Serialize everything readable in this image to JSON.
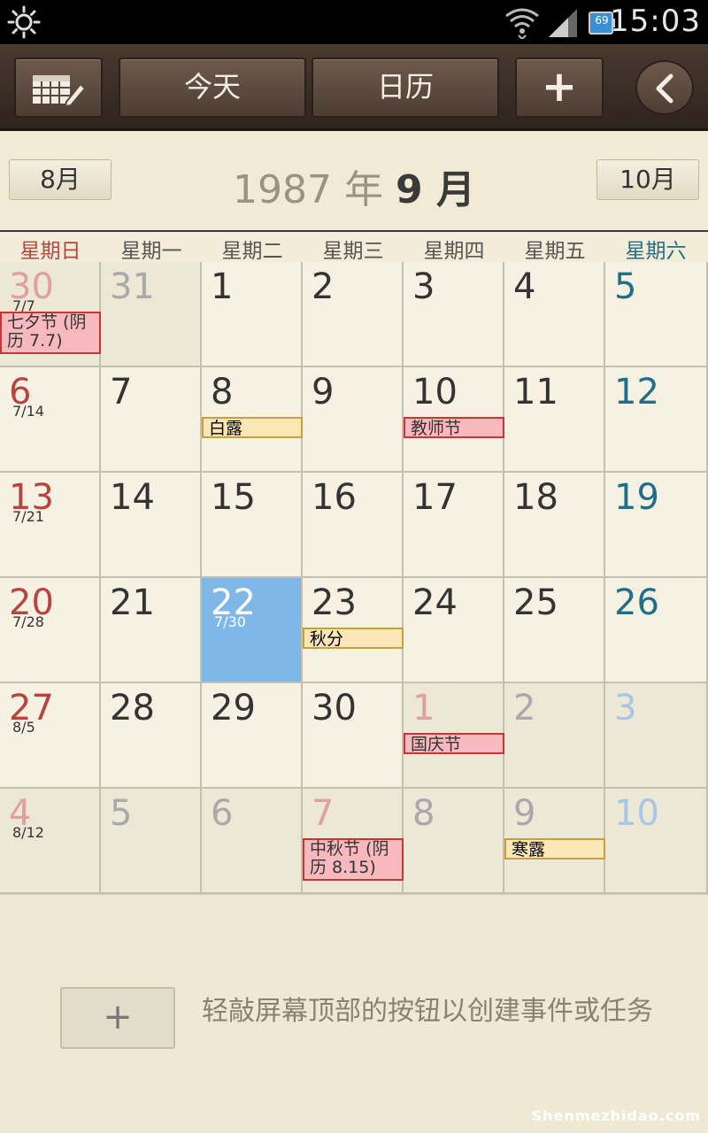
{
  "status_bar": {
    "time": "15:03",
    "battery": "69",
    "icons": [
      "brightness-icon",
      "wifi-icon",
      "signal-icon",
      "battery-icon"
    ]
  },
  "toolbar": {
    "today_label": "今天",
    "calendar_label": "日历",
    "add_label": "+",
    "icons": [
      "calendar-edit-icon",
      "back-icon"
    ]
  },
  "month_nav": {
    "prev_label": "8月",
    "next_label": "10月",
    "year": "1987",
    "year_suffix": "年",
    "month": "9 月"
  },
  "weekdays": [
    "星期日",
    "星期一",
    "星期二",
    "星期三",
    "星期四",
    "星期五",
    "星期六"
  ],
  "colors": {
    "sunday": "#b8453d",
    "saturday": "#1f6e8a",
    "other_month": "#a9a9a9",
    "selected": "#7fb8e8",
    "holiday_red": "#f7b9bd",
    "term_yellow": "#fbe6b8"
  },
  "weeks": [
    [
      {
        "day": "30",
        "lunar": "7/7",
        "other": true,
        "events": [
          {
            "text": "七夕节 (阴历 7.7)",
            "kind": "red",
            "tall": true
          }
        ]
      },
      {
        "day": "31",
        "other": true
      },
      {
        "day": "1"
      },
      {
        "day": "2"
      },
      {
        "day": "3"
      },
      {
        "day": "4"
      },
      {
        "day": "5"
      }
    ],
    [
      {
        "day": "6",
        "lunar": "7/14"
      },
      {
        "day": "7"
      },
      {
        "day": "8",
        "events": [
          {
            "text": "白露",
            "kind": "yel"
          }
        ]
      },
      {
        "day": "9"
      },
      {
        "day": "10",
        "events": [
          {
            "text": "教师节",
            "kind": "red"
          }
        ]
      },
      {
        "day": "11"
      },
      {
        "day": "12"
      }
    ],
    [
      {
        "day": "13",
        "lunar": "7/21"
      },
      {
        "day": "14"
      },
      {
        "day": "15"
      },
      {
        "day": "16"
      },
      {
        "day": "17"
      },
      {
        "day": "18"
      },
      {
        "day": "19"
      }
    ],
    [
      {
        "day": "20",
        "lunar": "7/28"
      },
      {
        "day": "21"
      },
      {
        "day": "22",
        "lunar": "7/30",
        "selected": true
      },
      {
        "day": "23",
        "events": [
          {
            "text": "秋分",
            "kind": "yel"
          }
        ]
      },
      {
        "day": "24"
      },
      {
        "day": "25"
      },
      {
        "day": "26"
      }
    ],
    [
      {
        "day": "27",
        "lunar": "8/5"
      },
      {
        "day": "28"
      },
      {
        "day": "29"
      },
      {
        "day": "30"
      },
      {
        "day": "1",
        "other": true,
        "events": [
          {
            "text": "国庆节",
            "kind": "red"
          }
        ]
      },
      {
        "day": "2",
        "other": true
      },
      {
        "day": "3",
        "other": true
      }
    ],
    [
      {
        "day": "4",
        "lunar": "8/12",
        "other": true
      },
      {
        "day": "5",
        "other": true
      },
      {
        "day": "6",
        "other": true
      },
      {
        "day": "7",
        "other": true,
        "events": [
          {
            "text": "中秋节 (阴历 8.15)",
            "kind": "red",
            "tall": true
          }
        ]
      },
      {
        "day": "8",
        "other": true
      },
      {
        "day": "9",
        "other": true,
        "events": [
          {
            "text": "寒露",
            "kind": "yel"
          }
        ]
      },
      {
        "day": "10",
        "other": true
      }
    ]
  ],
  "footer": {
    "add_label": "+",
    "hint": "轻敲屏幕顶部的按钮以创建事件或任务"
  },
  "watermark": "Shenmezhidao.com"
}
